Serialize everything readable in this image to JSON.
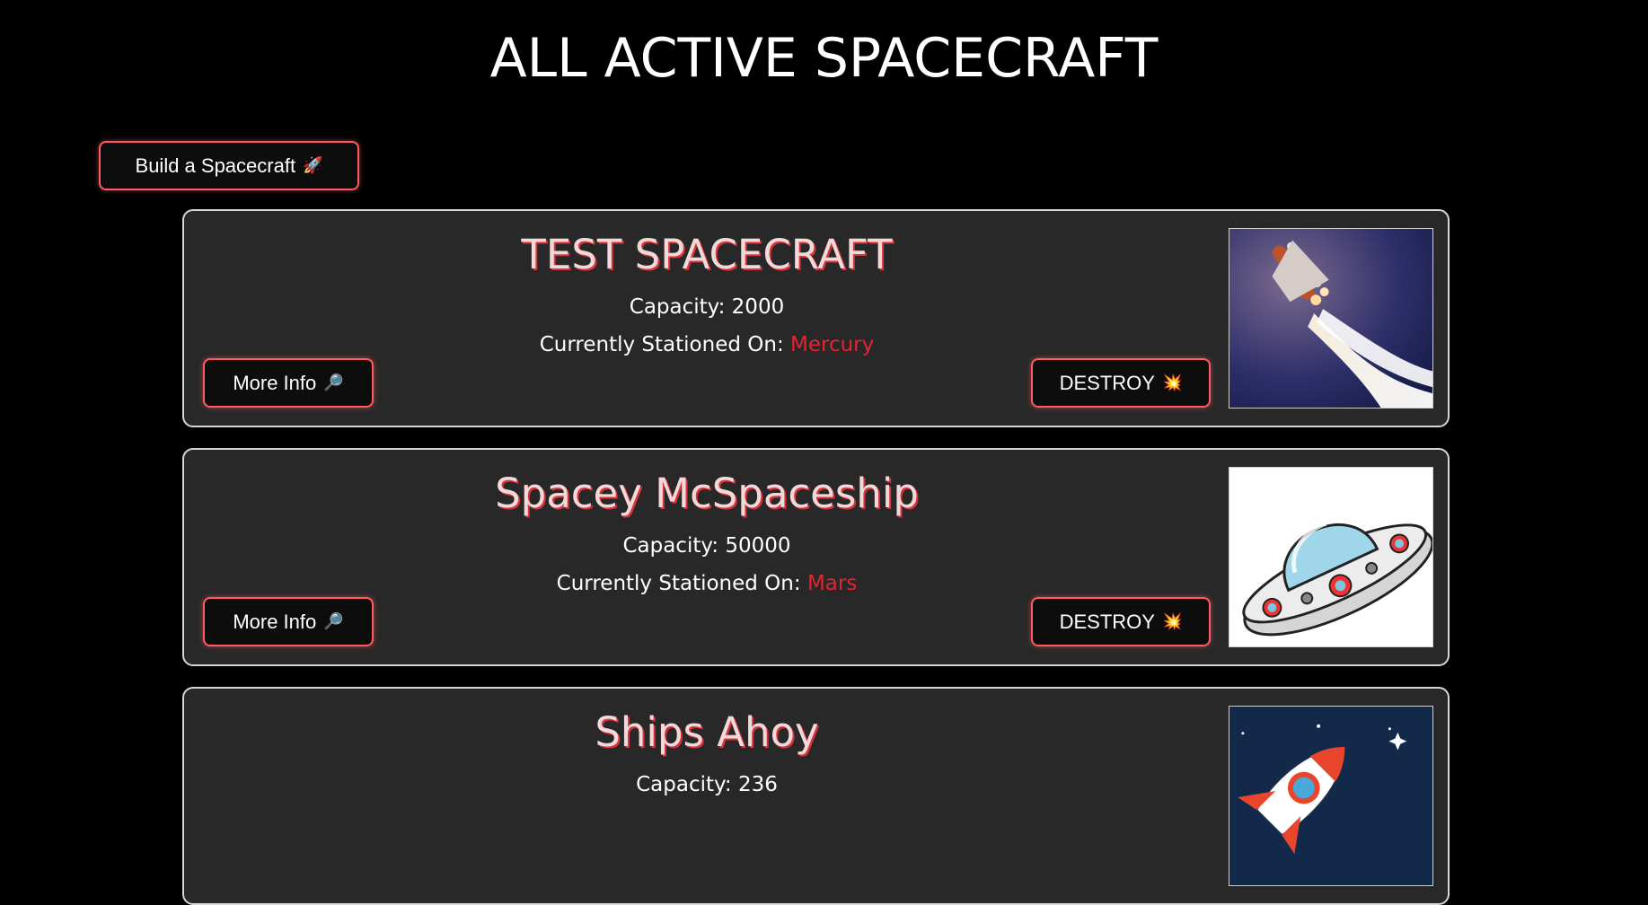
{
  "header": {
    "title": "ALL ACTIVE SPACECRAFT",
    "build_button_label": "Build a Spacecraft",
    "build_button_icon": "rocket-icon"
  },
  "labels": {
    "capacity_prefix": "Capacity: ",
    "station_prefix": "Currently Stationed On: ",
    "more_info": "More Info",
    "destroy": "DESTROY"
  },
  "colors": {
    "accent": "#ff5a5f",
    "planet": "#e3252f",
    "card_bg": "#282828"
  },
  "spacecraft": [
    {
      "name": "TEST SPACECRAFT",
      "capacity": "2000",
      "station": "Mercury",
      "image": "space-shuttle-launch-image"
    },
    {
      "name": "Spacey McSpaceship",
      "capacity": "50000",
      "station": "Mars",
      "image": "flying-saucer-cartoon-image"
    },
    {
      "name": "Ships Ahoy",
      "capacity": "236",
      "station": "",
      "image": "cartoon-rocket-image"
    }
  ]
}
